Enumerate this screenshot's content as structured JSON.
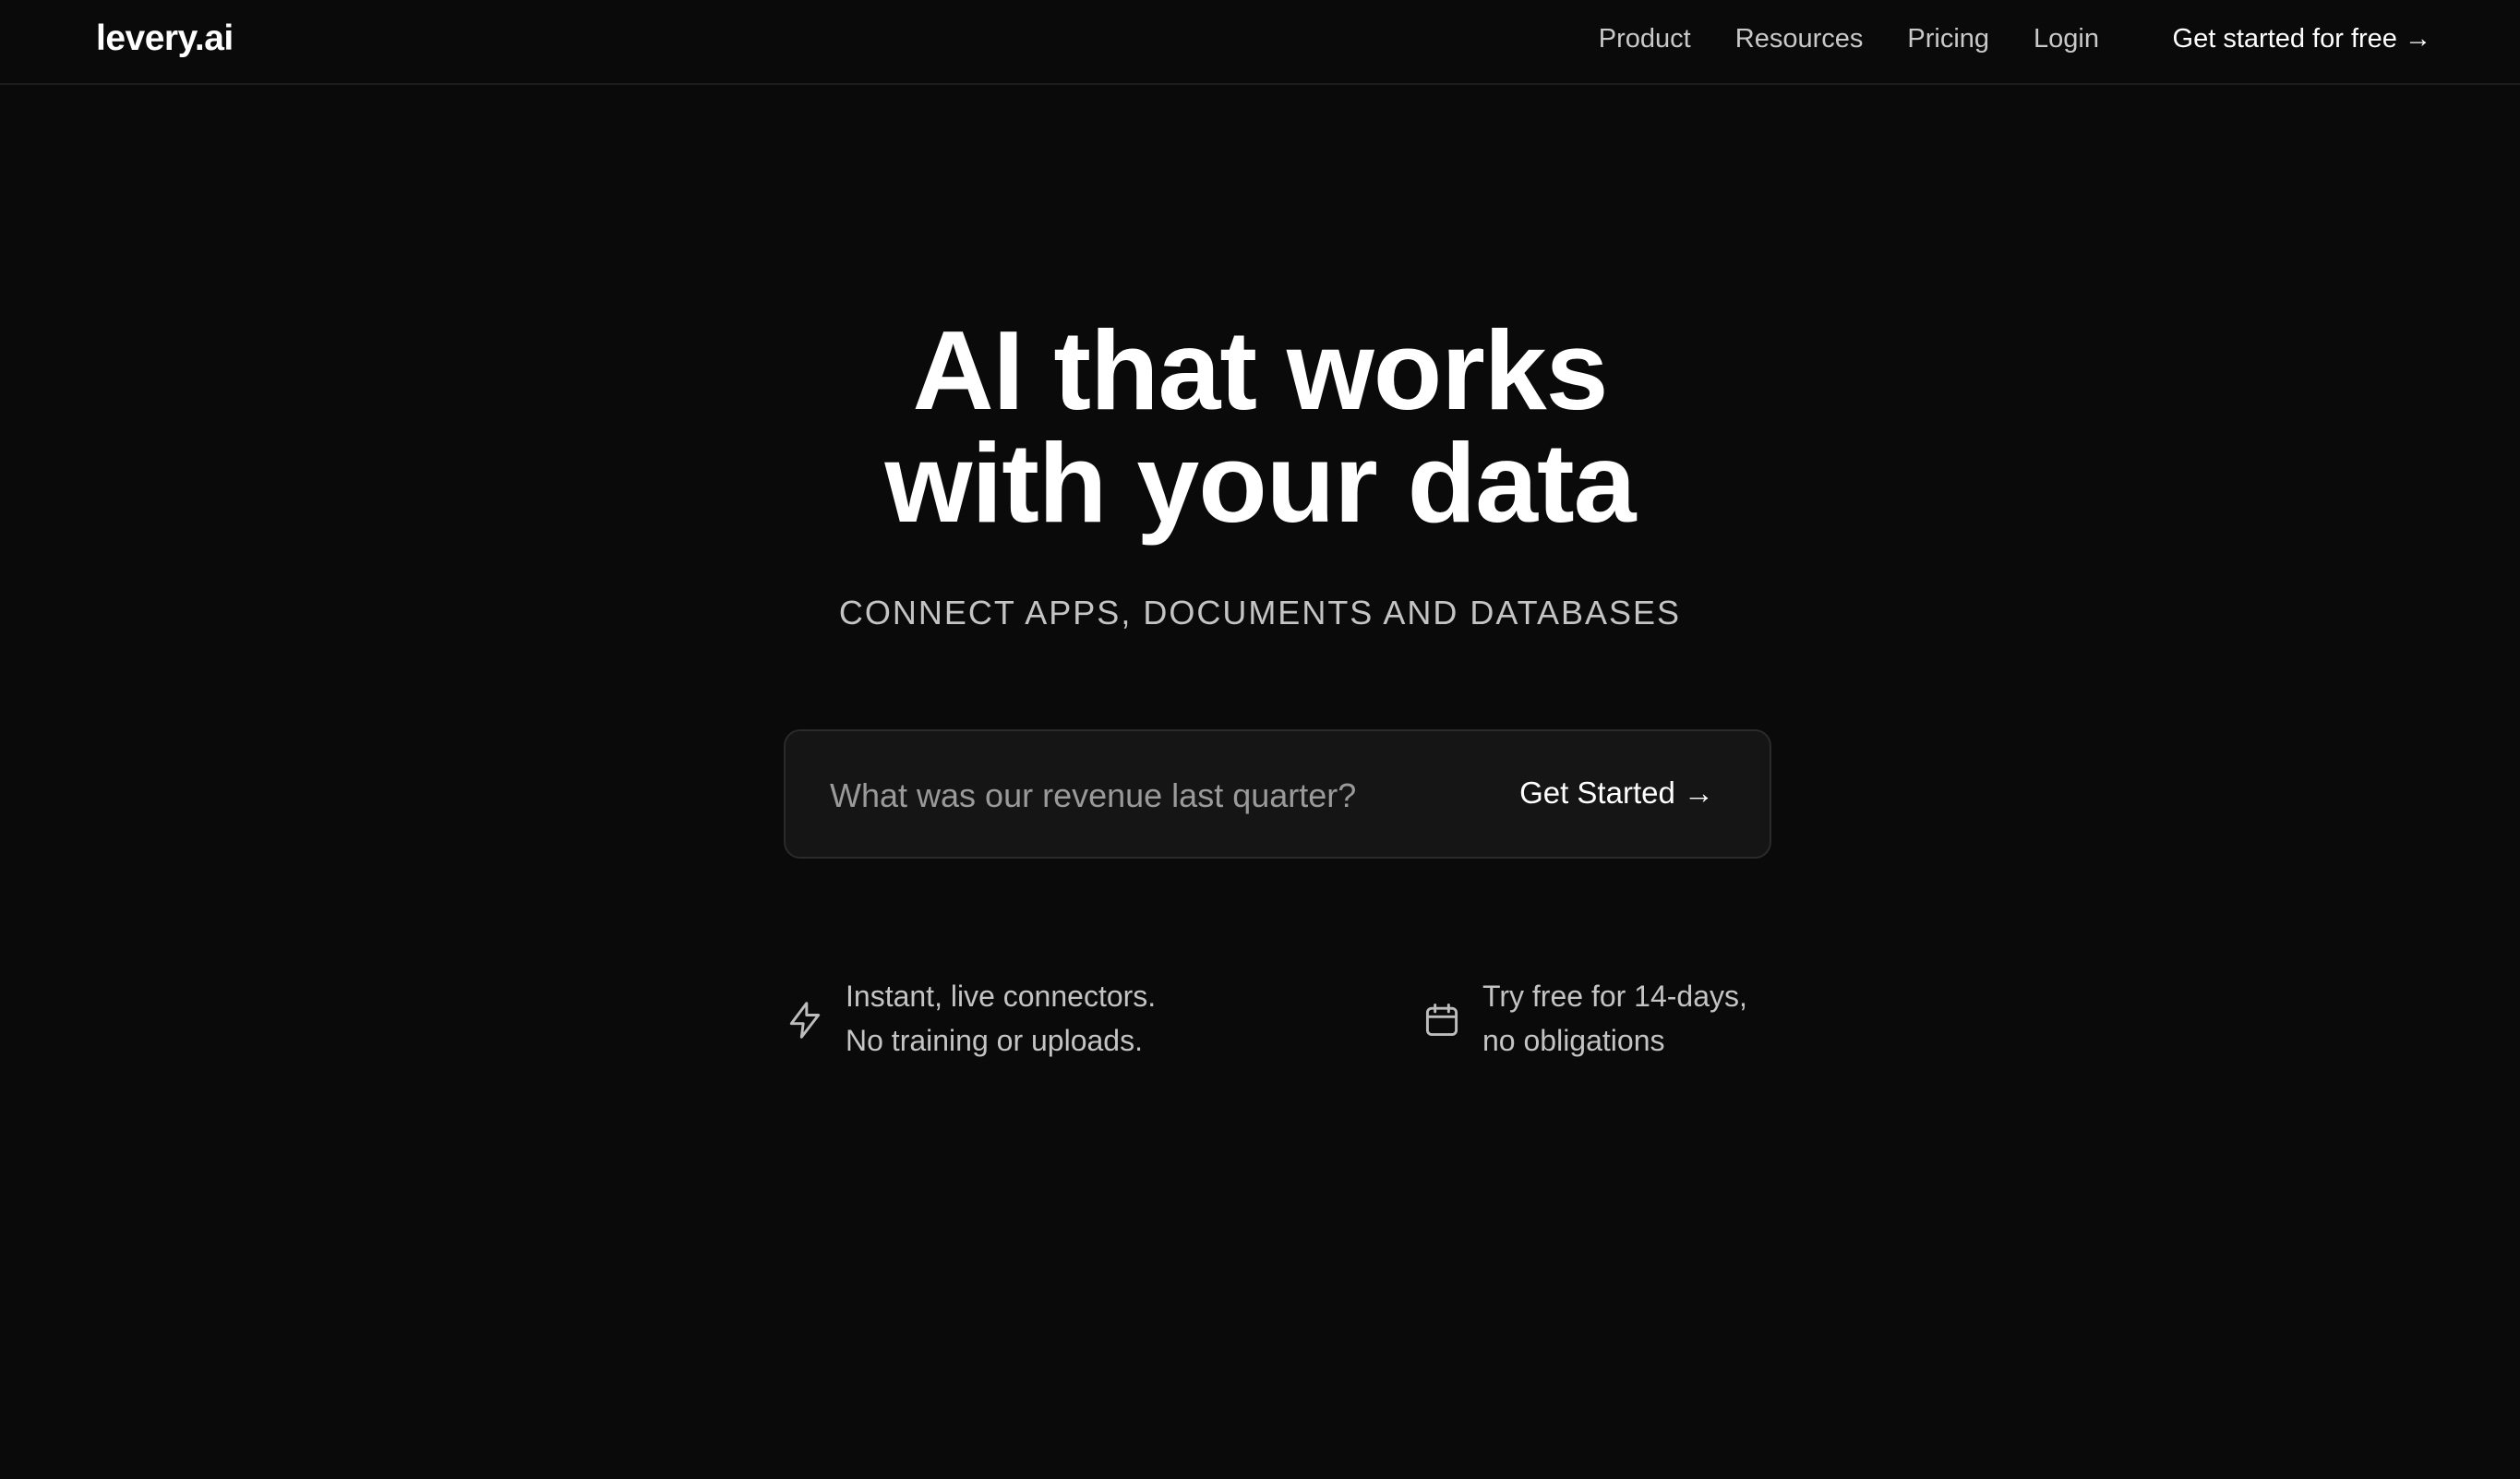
{
  "nav": {
    "logo": "levery.ai",
    "links": [
      "Product",
      "Resources",
      "Pricing",
      "Login"
    ],
    "cta": "Get started for free →"
  },
  "hero": {
    "title_line1": "AI that works",
    "title_line2": "with your data",
    "subtitle": "CONNECT APPS, DOCUMENTS AND DATABASES"
  },
  "prompt": {
    "placeholder": "What was our revenue last quarter?",
    "button_label": "Get Started →"
  },
  "features": [
    {
      "icon": "lightning-icon",
      "line1": "Instant, live connectors.",
      "line2": "No training or uploads."
    },
    {
      "icon": "calendar-icon",
      "line1": "Try free for 14-days,",
      "line2": "no obligations"
    }
  ],
  "colors": {
    "background": "#0a0a0a",
    "text_primary": "#ffffff",
    "text_secondary": "#c4c4c4",
    "input_bg": "#151515",
    "input_border": "#2a2a2a"
  }
}
